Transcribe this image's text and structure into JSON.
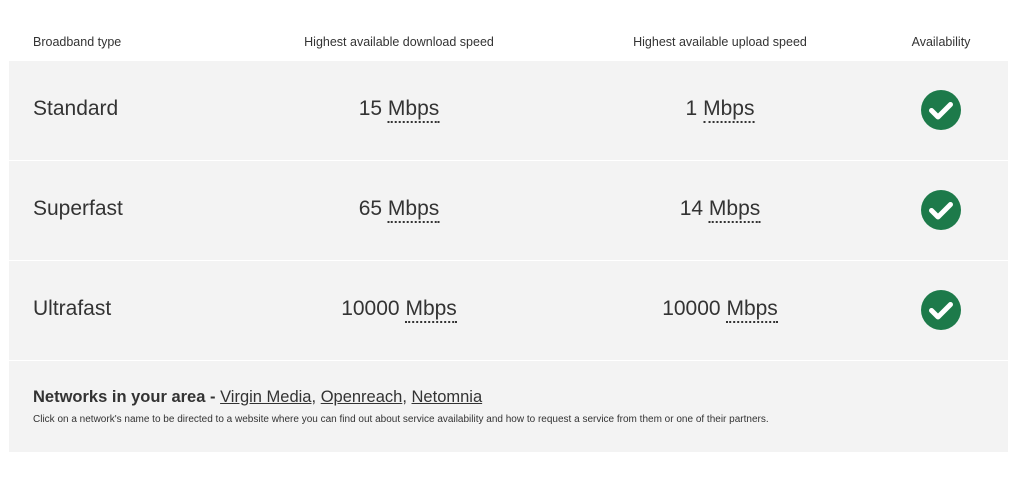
{
  "table": {
    "headers": {
      "type": "Broadband type",
      "download": "Highest available download speed",
      "upload": "Highest available upload speed",
      "availability": "Availability"
    },
    "rows": [
      {
        "type": "Standard",
        "download_value": "15",
        "upload_value": "1",
        "unit": "Mbps",
        "available": true
      },
      {
        "type": "Superfast",
        "download_value": "65",
        "upload_value": "14",
        "unit": "Mbps",
        "available": true
      },
      {
        "type": "Ultrafast",
        "download_value": "10000",
        "upload_value": "10000",
        "unit": "Mbps",
        "available": true
      }
    ],
    "check_icon": "check-circle-icon",
    "check_color": "#1d7a4a"
  },
  "networks": {
    "title": "Networks in your area -",
    "links": [
      "Virgin Media",
      "Openreach",
      "Netomnia"
    ],
    "separator": ",",
    "note": "Click on a network's name to be directed to a website where you can find out about service availability and how to request a service from them or one of their partners."
  }
}
